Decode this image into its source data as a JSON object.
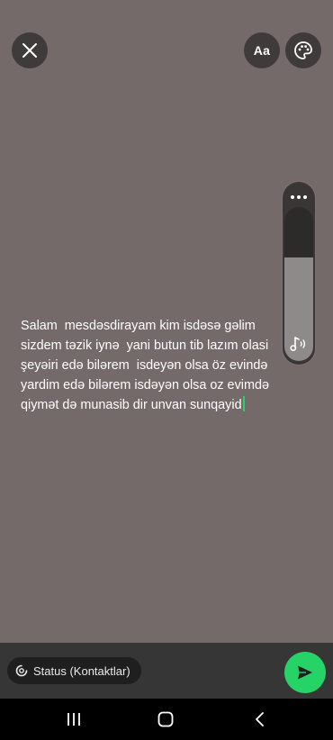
{
  "toolbar": {
    "close_icon": "close-icon",
    "font_label": "Aa",
    "palette_icon": "palette-icon"
  },
  "volume": {
    "menu_icon": "more-icon",
    "level": 0.67,
    "icon": "music-volume-icon"
  },
  "status": {
    "text": "Salam  mesdəsdirayam kim isdəsə gəlim sizdem təzik iynə  yani butun tib lazım olasi şeyəiri edə bilərem  isdeyən olsa öz evində yardim edə bilərem isdəyən olsa oz evimdə qiymət də munasib dir unvan sunqayid"
  },
  "composer": {
    "audience_label": "Status (Kontaktlar)",
    "audience_icon": "status-ring-icon",
    "send_icon": "send-icon",
    "accent_color": "#25d366"
  },
  "navbar": {
    "recent_icon": "recent-apps-icon",
    "home_icon": "home-icon",
    "back_icon": "back-icon"
  }
}
